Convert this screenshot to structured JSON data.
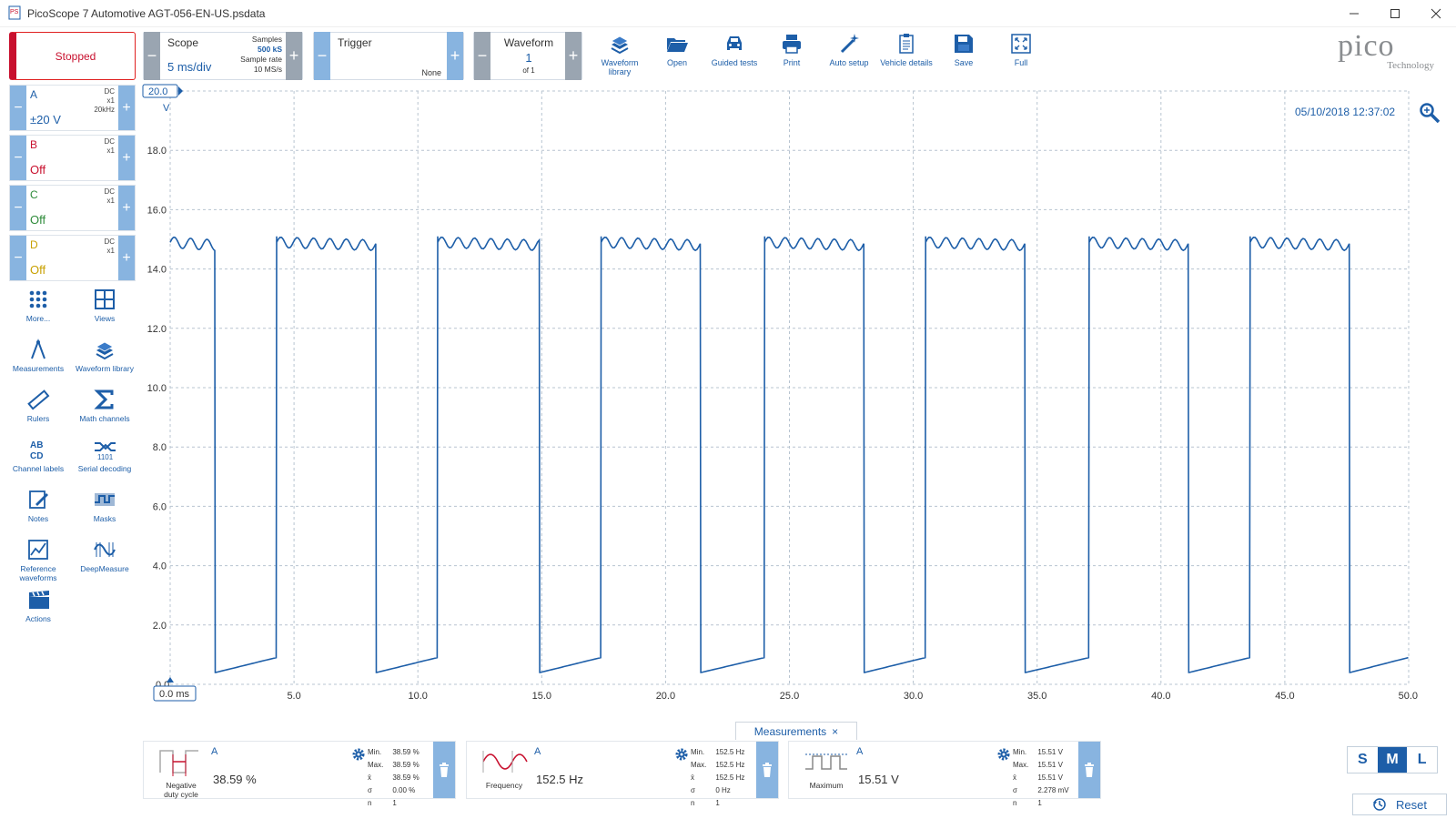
{
  "window": {
    "title": "PicoScope 7 Automotive AGT-056-EN-US.psdata",
    "app_icon_text": "PS"
  },
  "toolbar": {
    "run_state": "Stopped",
    "scope": {
      "label": "Scope",
      "timebase": "5 ms/div",
      "samples_label": "Samples",
      "samples": "500 kS",
      "rate_label": "Sample rate",
      "rate": "10 MS/s"
    },
    "trigger": {
      "label": "Trigger",
      "mode": "None"
    },
    "waveform": {
      "label": "Waveform",
      "index": "1",
      "of": "of 1"
    },
    "items": [
      {
        "label": "Waveform library",
        "icon": "waveform-library-icon"
      },
      {
        "label": "Open",
        "icon": "folder-open-icon"
      },
      {
        "label": "Guided tests",
        "icon": "car-icon"
      },
      {
        "label": "Print",
        "icon": "printer-icon"
      },
      {
        "label": "Auto setup",
        "icon": "magic-wand-icon"
      },
      {
        "label": "Vehicle details",
        "icon": "clipboard-icon"
      },
      {
        "label": "Save",
        "icon": "save-icon"
      },
      {
        "label": "Full",
        "icon": "fullscreen-icon"
      }
    ],
    "brand": {
      "name": "pico",
      "sub": "Technology"
    }
  },
  "channels": [
    {
      "name": "A",
      "coupling": "DC",
      "probe": "x1",
      "bw": "20kHz",
      "range": "±20 V",
      "color": "#1d5ea8"
    },
    {
      "name": "B",
      "coupling": "DC",
      "probe": "x1",
      "bw": "",
      "range": "Off",
      "color": "#c8102e"
    },
    {
      "name": "C",
      "coupling": "DC",
      "probe": "x1",
      "bw": "",
      "range": "Off",
      "color": "#2e8b3a"
    },
    {
      "name": "D",
      "coupling": "DC",
      "probe": "x1",
      "bw": "",
      "range": "Off",
      "color": "#c8a000"
    }
  ],
  "tools": [
    {
      "label": "More...",
      "icon": "grid-dots-icon"
    },
    {
      "label": "Views",
      "icon": "views-icon"
    },
    {
      "label": "Measurements",
      "icon": "measurements-icon"
    },
    {
      "label": "Waveform library",
      "icon": "waveform-library-icon"
    },
    {
      "label": "Rulers",
      "icon": "ruler-icon"
    },
    {
      "label": "Math channels",
      "icon": "sigma-icon"
    },
    {
      "label": "Channel labels",
      "icon": "channel-labels-icon"
    },
    {
      "label": "Serial decoding",
      "icon": "serial-decoding-icon"
    },
    {
      "label": "Notes",
      "icon": "notes-icon"
    },
    {
      "label": "Masks",
      "icon": "masks-icon"
    },
    {
      "label": "Reference waveforms",
      "icon": "reference-waveforms-icon"
    },
    {
      "label": "DeepMeasure",
      "icon": "deepmeasure-icon"
    },
    {
      "label": "Actions",
      "icon": "clapperboard-icon"
    }
  ],
  "scope_view": {
    "timestamp": "05/10/2018 12:37:02",
    "y_unit": "V",
    "y_top_label": "20.0",
    "x_unit_label": "0.0 ms"
  },
  "chart_data": {
    "type": "line",
    "xlabel": "ms",
    "ylabel": "V",
    "xlim": [
      0,
      50
    ],
    "ylim": [
      0,
      20
    ],
    "x_ticks": [
      "0.0 ms",
      "5.0",
      "10.0",
      "15.0",
      "20.0",
      "25.0",
      "30.0",
      "35.0",
      "40.0",
      "45.0",
      "50.0"
    ],
    "y_ticks": [
      "0.0",
      "2.0",
      "4.0",
      "6.0",
      "8.0",
      "10.0",
      "12.0",
      "14.0",
      "16.0",
      "18.0",
      "20.0"
    ],
    "grid": true,
    "series": [
      {
        "name": "A",
        "color": "#1d5ea8",
        "high_level_v": 14.9,
        "low_level_v_start": 0.4,
        "low_level_v_end": 0.9,
        "high_intervals_ms": [
          [
            0.0,
            1.8
          ],
          [
            4.3,
            8.3
          ],
          [
            10.8,
            14.9
          ],
          [
            17.4,
            21.4
          ],
          [
            24.0,
            28.0
          ],
          [
            30.5,
            34.5
          ],
          [
            37.1,
            41.1
          ],
          [
            43.6,
            47.6
          ]
        ]
      }
    ]
  },
  "measurements": {
    "tab_label": "Measurements",
    "cards": [
      {
        "channel": "A",
        "label": "Negative duty cycle",
        "value": "38.59 %",
        "icon": "duty-cycle-icon",
        "stats": [
          [
            "Min.",
            "38.59 %"
          ],
          [
            "Max.",
            "38.59 %"
          ],
          [
            "x̄",
            "38.59 %"
          ],
          [
            "σ",
            "0.00 %"
          ],
          [
            "n",
            "1"
          ]
        ]
      },
      {
        "channel": "A",
        "label": "Frequency",
        "value": "152.5 Hz",
        "icon": "frequency-icon",
        "stats": [
          [
            "Min.",
            "152.5 Hz"
          ],
          [
            "Max.",
            "152.5 Hz"
          ],
          [
            "x̄",
            "152.5 Hz"
          ],
          [
            "σ",
            "0 Hz"
          ],
          [
            "n",
            "1"
          ]
        ]
      },
      {
        "channel": "A",
        "label": "Maximum",
        "value": "15.51 V",
        "icon": "maximum-icon",
        "stats": [
          [
            "Min.",
            "15.51 V"
          ],
          [
            "Max.",
            "15.51 V"
          ],
          [
            "x̄",
            "15.51 V"
          ],
          [
            "σ",
            "2.278 mV"
          ],
          [
            "n",
            "1"
          ]
        ]
      }
    ]
  },
  "view_size": {
    "options": [
      "S",
      "M",
      "L"
    ],
    "selected": "M"
  },
  "reset_label": "Reset"
}
